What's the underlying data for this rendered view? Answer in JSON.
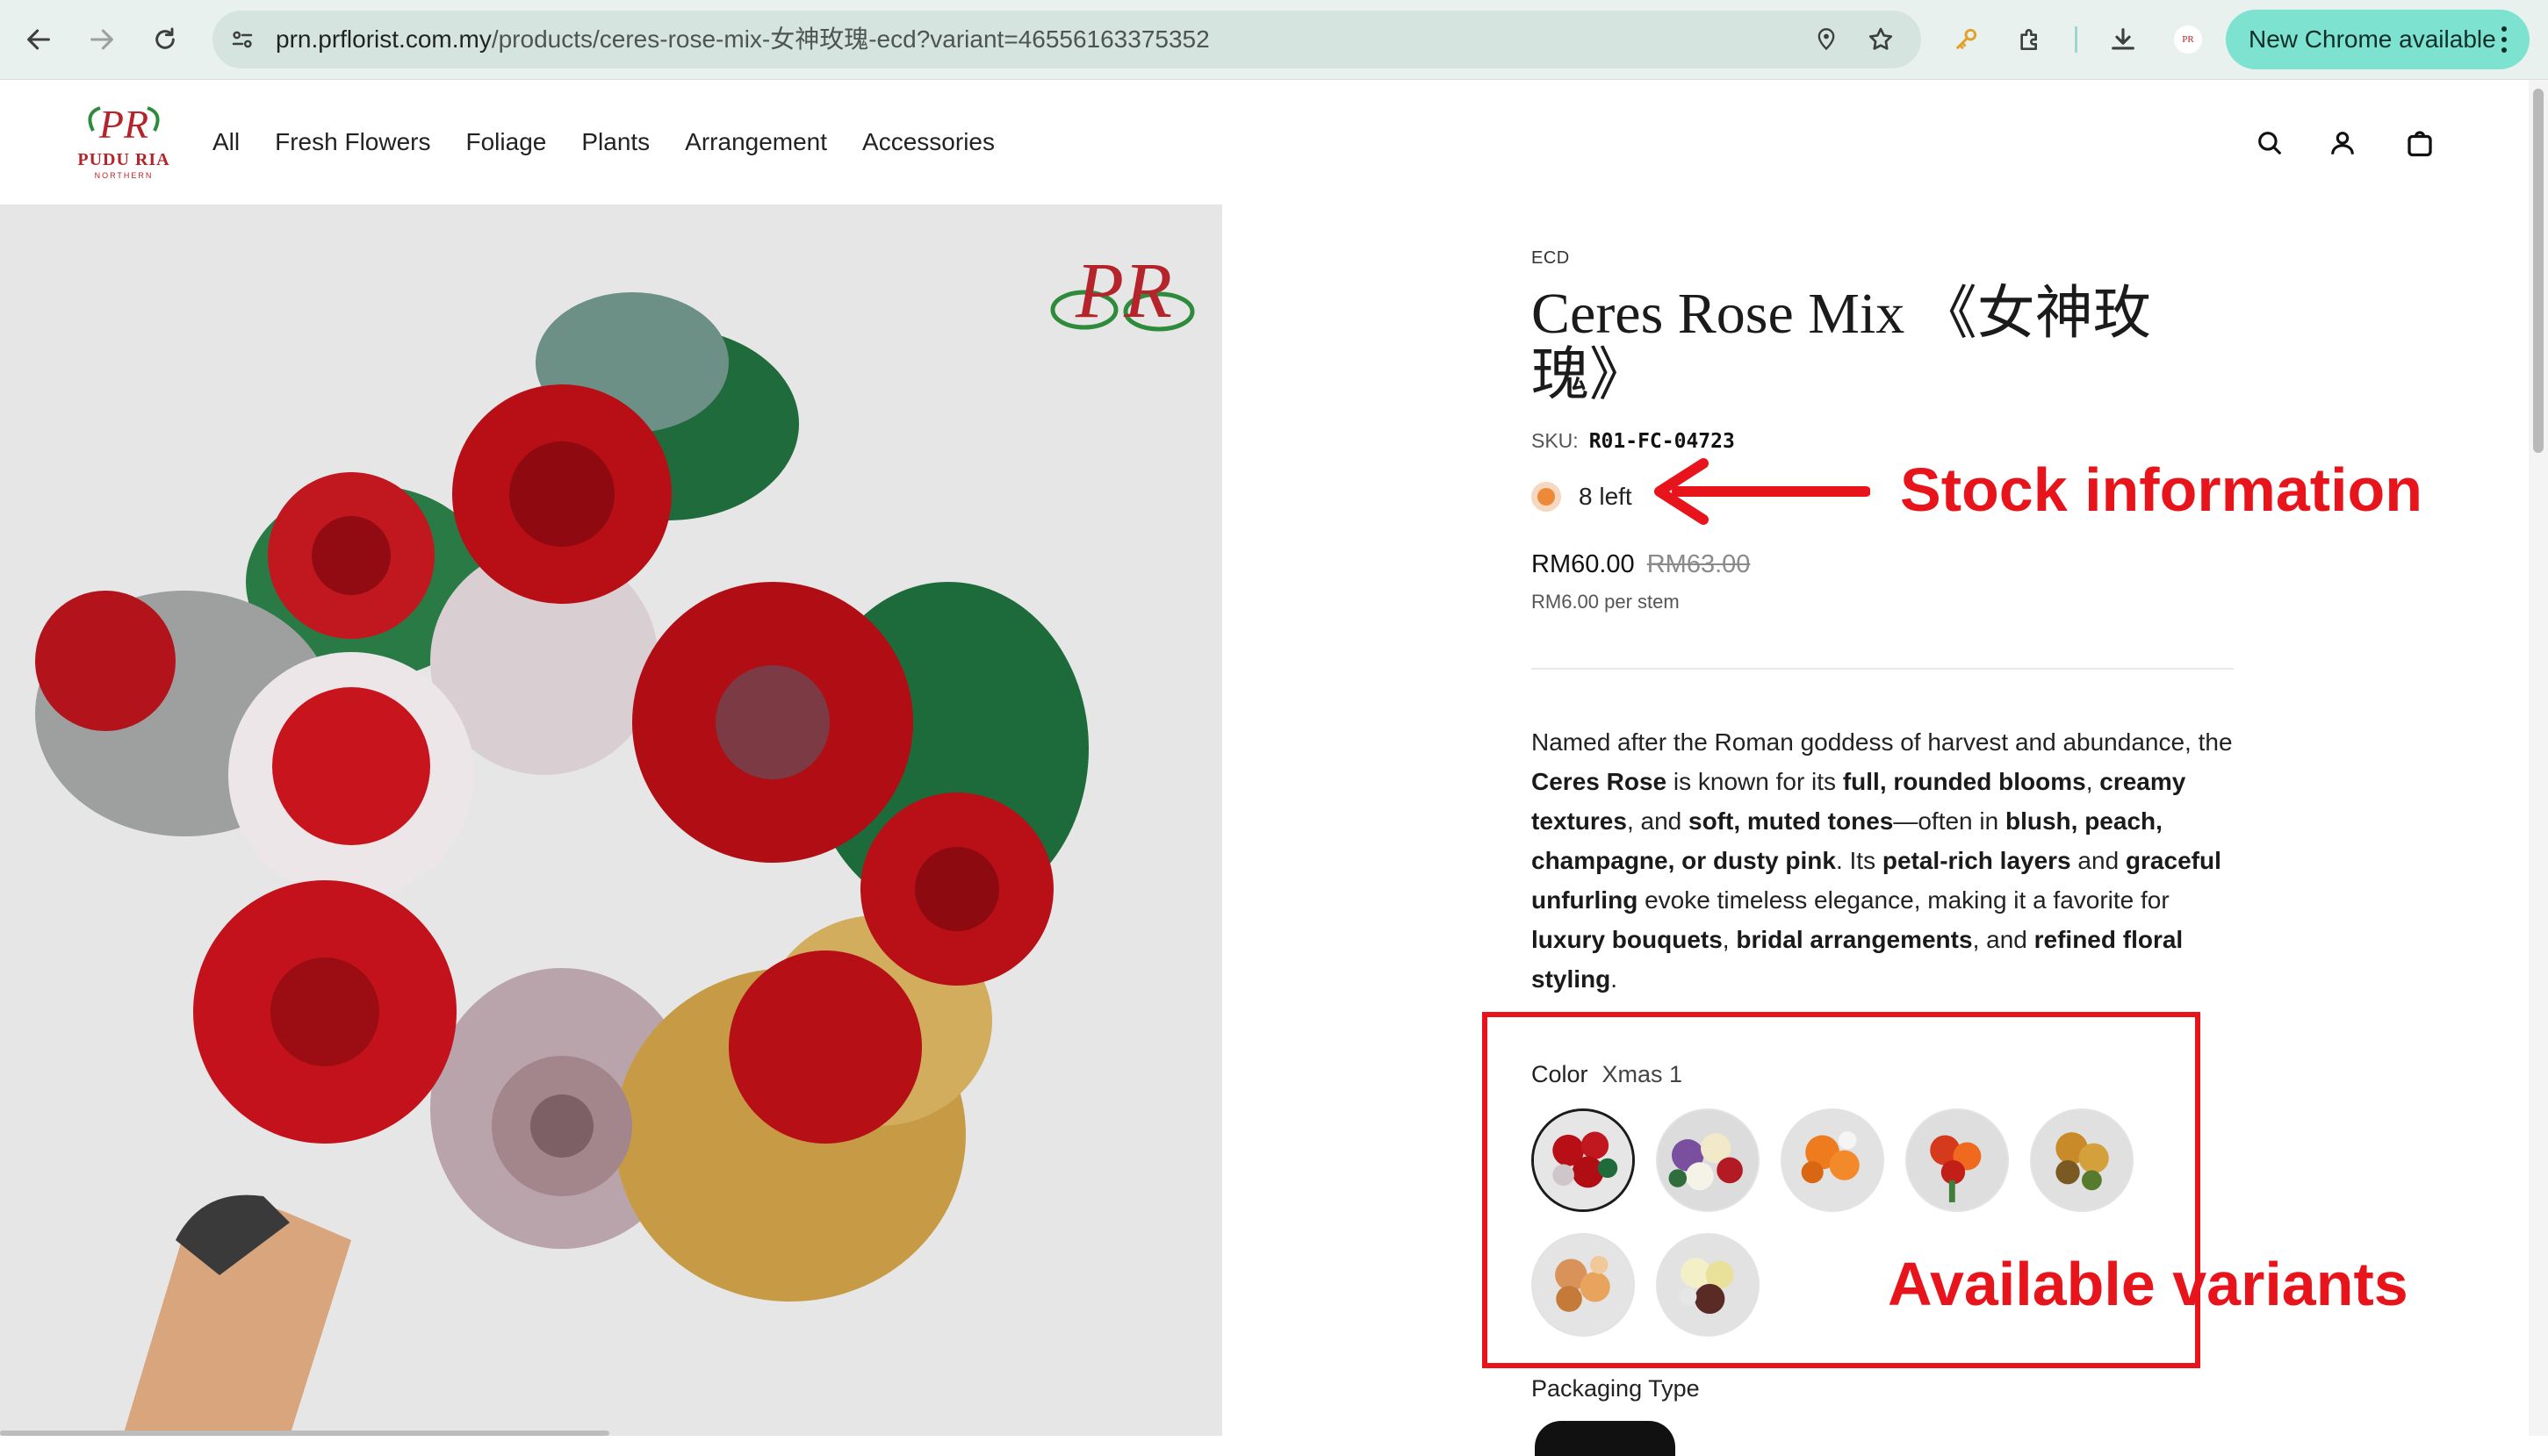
{
  "browser": {
    "url_domain": "prn.prflorist.com.my",
    "url_path": "/products/ceres-rose-mix-女神玫瑰-ecd?variant=46556163375352",
    "update_label": "New Chrome available",
    "accent": "#7de3d0"
  },
  "site": {
    "logo_text": "PUDU RIA",
    "logo_sub": "NORTHERN",
    "nav": [
      "All",
      "Fresh Flowers",
      "Foliage",
      "Plants",
      "Arrangement",
      "Accessories"
    ],
    "brand_color": "#b5242a"
  },
  "product": {
    "vendor": "ECD",
    "title": "Ceres Rose Mix 《女神玫瑰》",
    "sku_label": "SKU:",
    "sku": "R01-FC-04723",
    "stock": "8 left",
    "stock_color": "#ec8a3a",
    "price": "RM60.00",
    "compare_price": "RM63.00",
    "unit_price": "RM6.00 per stem",
    "description": {
      "t1": "Named after the Roman goddess of harvest and abundance, the ",
      "b1": "Ceres Rose",
      "t2": " is known for its ",
      "b2": "full, rounded blooms",
      "t3": ", ",
      "b3": "creamy textures",
      "t4": ", and ",
      "b4": "soft, muted tones",
      "t5": "—often in ",
      "b5": "blush, peach, champagne, or dusty pink",
      "t6": ". Its ",
      "b6": "petal-rich layers",
      "t7": " and ",
      "b7": "graceful unfurling",
      "t8": " evoke timeless elegance, making it a favorite for ",
      "b8": "luxury bouquets",
      "t9": ", ",
      "b9": "bridal arrangements",
      "t10": ", and ",
      "b10": "refined floral styling",
      "t11": "."
    },
    "color_label": "Color",
    "color_value": "Xmas 1",
    "swatch_count": 7,
    "selected_swatch": 1,
    "packaging_label": "Packaging Type"
  },
  "annotations": {
    "stock": "Stock information",
    "variants": "Available variants",
    "color": "#e8141c"
  }
}
